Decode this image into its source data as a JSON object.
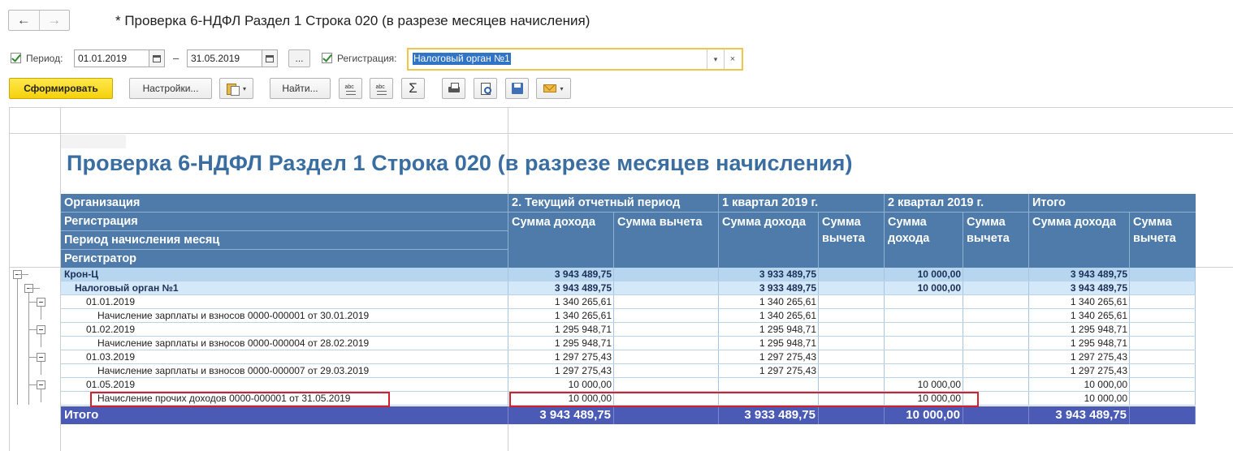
{
  "window": {
    "title": "* Проверка 6-НДФЛ Раздел 1 Строка 020 (в разрезе месяцев начисления)",
    "nav_back": "←",
    "nav_forward": "→"
  },
  "filters": {
    "period_label": "Период:",
    "period_from": "01.01.2019",
    "period_dash": "–",
    "period_to": "31.05.2019",
    "period_more": "...",
    "registration_label": "Регистрация:",
    "registration_value": "Налоговый орган №1",
    "dropdown_glyph": "▾",
    "clear_glyph": "×"
  },
  "toolbar": {
    "generate_label": "Сформировать",
    "settings_label": "Настройки...",
    "find_label": "Найти...",
    "sum_glyph": "Σ",
    "caret_glyph": "▾"
  },
  "report": {
    "title": "Проверка 6-НДФЛ Раздел 1 Строка 020 (в разрезе месяцев начисления)",
    "row_headers": [
      "Организация",
      "Регистрация",
      "Период начисления месяц",
      "Регистратор"
    ],
    "column_groups": [
      "2. Текущий отчетный период",
      "1 квартал 2019 г.",
      "2 квартал 2019 г.",
      "Итого"
    ],
    "income_header": "Сумма дохода",
    "deduction_header": "Сумма вычета",
    "rows": [
      {
        "label": "Крон-Ц",
        "level": 0,
        "values": [
          "3 943 489,75",
          "",
          "3 933 489,75",
          "",
          "10 000,00",
          "",
          "3 943 489,75",
          ""
        ]
      },
      {
        "label": "Налоговый орган №1",
        "level": 1,
        "values": [
          "3 943 489,75",
          "",
          "3 933 489,75",
          "",
          "10 000,00",
          "",
          "3 943 489,75",
          ""
        ]
      },
      {
        "label": "01.01.2019",
        "level": 2,
        "values": [
          "1 340 265,61",
          "",
          "1 340 265,61",
          "",
          "",
          "",
          "1 340 265,61",
          ""
        ]
      },
      {
        "label": "Начисление зарплаты и взносов 0000-000001 от 30.01.2019",
        "level": 3,
        "values": [
          "1 340 265,61",
          "",
          "1 340 265,61",
          "",
          "",
          "",
          "1 340 265,61",
          ""
        ]
      },
      {
        "label": "01.02.2019",
        "level": 2,
        "values": [
          "1 295 948,71",
          "",
          "1 295 948,71",
          "",
          "",
          "",
          "1 295 948,71",
          ""
        ]
      },
      {
        "label": "Начисление зарплаты и взносов 0000-000004 от 28.02.2019",
        "level": 3,
        "values": [
          "1 295 948,71",
          "",
          "1 295 948,71",
          "",
          "",
          "",
          "1 295 948,71",
          ""
        ]
      },
      {
        "label": "01.03.2019",
        "level": 2,
        "values": [
          "1 297 275,43",
          "",
          "1 297 275,43",
          "",
          "",
          "",
          "1 297 275,43",
          ""
        ]
      },
      {
        "label": "Начисление зарплаты и взносов 0000-000007 от 29.03.2019",
        "level": 3,
        "values": [
          "1 297 275,43",
          "",
          "1 297 275,43",
          "",
          "",
          "",
          "1 297 275,43",
          ""
        ]
      },
      {
        "label": "01.05.2019",
        "level": 2,
        "values": [
          "10 000,00",
          "",
          "",
          "",
          "10 000,00",
          "",
          "10 000,00",
          ""
        ]
      },
      {
        "label": "Начисление прочих доходов 0000-000001 от 31.05.2019",
        "level": 3,
        "values": [
          "10 000,00",
          "",
          "",
          "",
          "10 000,00",
          "",
          "10 000,00",
          ""
        ]
      }
    ],
    "total": {
      "label": "Итого",
      "values": [
        "3 943 489,75",
        "",
        "3 933 489,75",
        "",
        "10 000,00",
        "",
        "3 943 489,75",
        ""
      ]
    }
  }
}
